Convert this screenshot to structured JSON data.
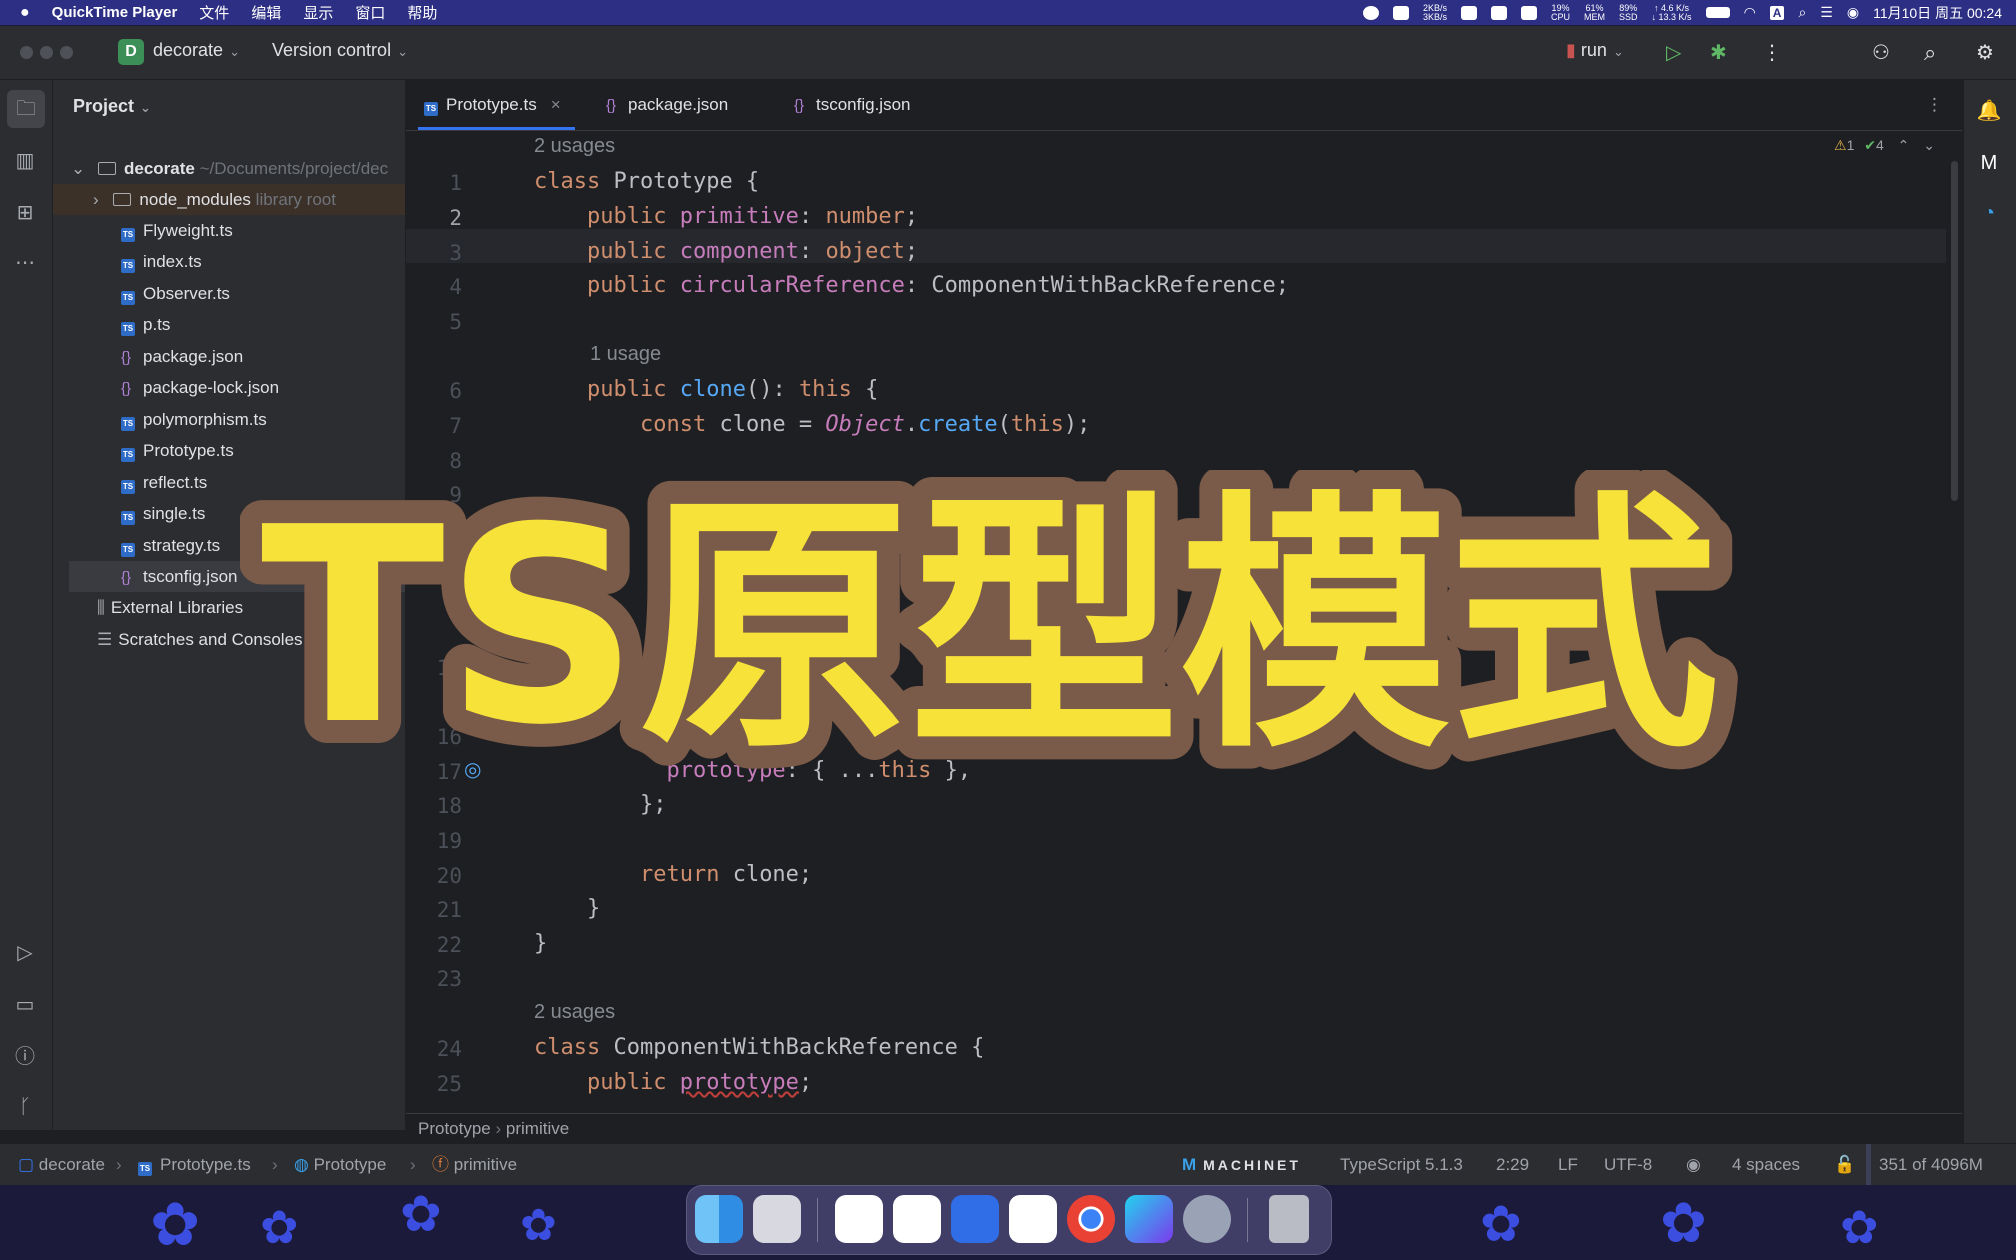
{
  "menubar": {
    "app_name": "QuickTime Player",
    "menus": [
      "文件",
      "编辑",
      "显示",
      "窗口",
      "帮助"
    ],
    "net_up": "2KB/s",
    "net_down": "3KB/s",
    "cpu": "19%",
    "cpu_label": "CPU",
    "mem": "61%",
    "mem_label": "MEM",
    "ssd": "89%",
    "ssd_label": "SSD",
    "rate_up": "↑ 4.6 K/s",
    "rate_down": "↓ 13.3 K/s",
    "input_method": "A",
    "datetime": "11月10日 周五  00:24"
  },
  "toolbar": {
    "project_badge": "D",
    "project_name": "decorate",
    "vcs": "Version control",
    "run_config": "run"
  },
  "project_panel": {
    "title": "Project",
    "root_name": "decorate",
    "root_path": "~/Documents/project/dec",
    "items": [
      {
        "label": "node_modules",
        "hint": "library root",
        "icon": "folder-icon"
      },
      {
        "label": "Flyweight.ts",
        "icon": "typescript-file-icon"
      },
      {
        "label": "index.ts",
        "icon": "typescript-file-icon"
      },
      {
        "label": "Observer.ts",
        "icon": "typescript-file-icon"
      },
      {
        "label": "p.ts",
        "icon": "typescript-file-icon"
      },
      {
        "label": "package.json",
        "icon": "json-file-icon"
      },
      {
        "label": "package-lock.json",
        "icon": "json-file-icon"
      },
      {
        "label": "polymorphism.ts",
        "icon": "typescript-file-icon"
      },
      {
        "label": "Prototype.ts",
        "icon": "typescript-file-icon"
      },
      {
        "label": "reflect.ts",
        "icon": "typescript-file-icon"
      },
      {
        "label": "single.ts",
        "icon": "typescript-file-icon"
      },
      {
        "label": "strategy.ts",
        "icon": "typescript-file-icon"
      },
      {
        "label": "tsconfig.json",
        "icon": "json-file-icon"
      }
    ],
    "external_libraries": "External Libraries",
    "scratches": "Scratches and Consoles"
  },
  "tabs": [
    {
      "label": "Prototype.ts",
      "icon": "typescript-file-icon"
    },
    {
      "label": "package.json",
      "icon": "json-file-icon"
    },
    {
      "label": "tsconfig.json",
      "icon": "json-file-icon"
    }
  ],
  "inspections": {
    "warnings": "1",
    "ok": "4"
  },
  "editor": {
    "usage_top": "2 usages",
    "usage_clone": "1 usage",
    "usage_bottom": "2 usages",
    "line_numbers": [
      "1",
      "2",
      "3",
      "4",
      "5",
      "6",
      "7",
      "8",
      "9",
      "14",
      "16",
      "17",
      "18",
      "19",
      "20",
      "21",
      "22",
      "23",
      "24",
      "25"
    ]
  },
  "overlay_title": "TS原型模式",
  "breadcrumb": {
    "class": "Prototype",
    "member": "primitive"
  },
  "status_bar": {
    "path": [
      "decorate",
      "Prototype.ts",
      "Prototype",
      "primitive"
    ],
    "plugin": "MACHINET",
    "language": "TypeScript 5.1.3",
    "position": "2:29",
    "line_ending": "LF",
    "encoding": "UTF-8",
    "indent": "4 spaces",
    "memory": "351 of 4096M"
  },
  "colors": {
    "accent": "#3574f0",
    "overlay_fill": "#f7e23a",
    "overlay_stroke": "#7a5a48",
    "menubar": "#2c2f84"
  }
}
